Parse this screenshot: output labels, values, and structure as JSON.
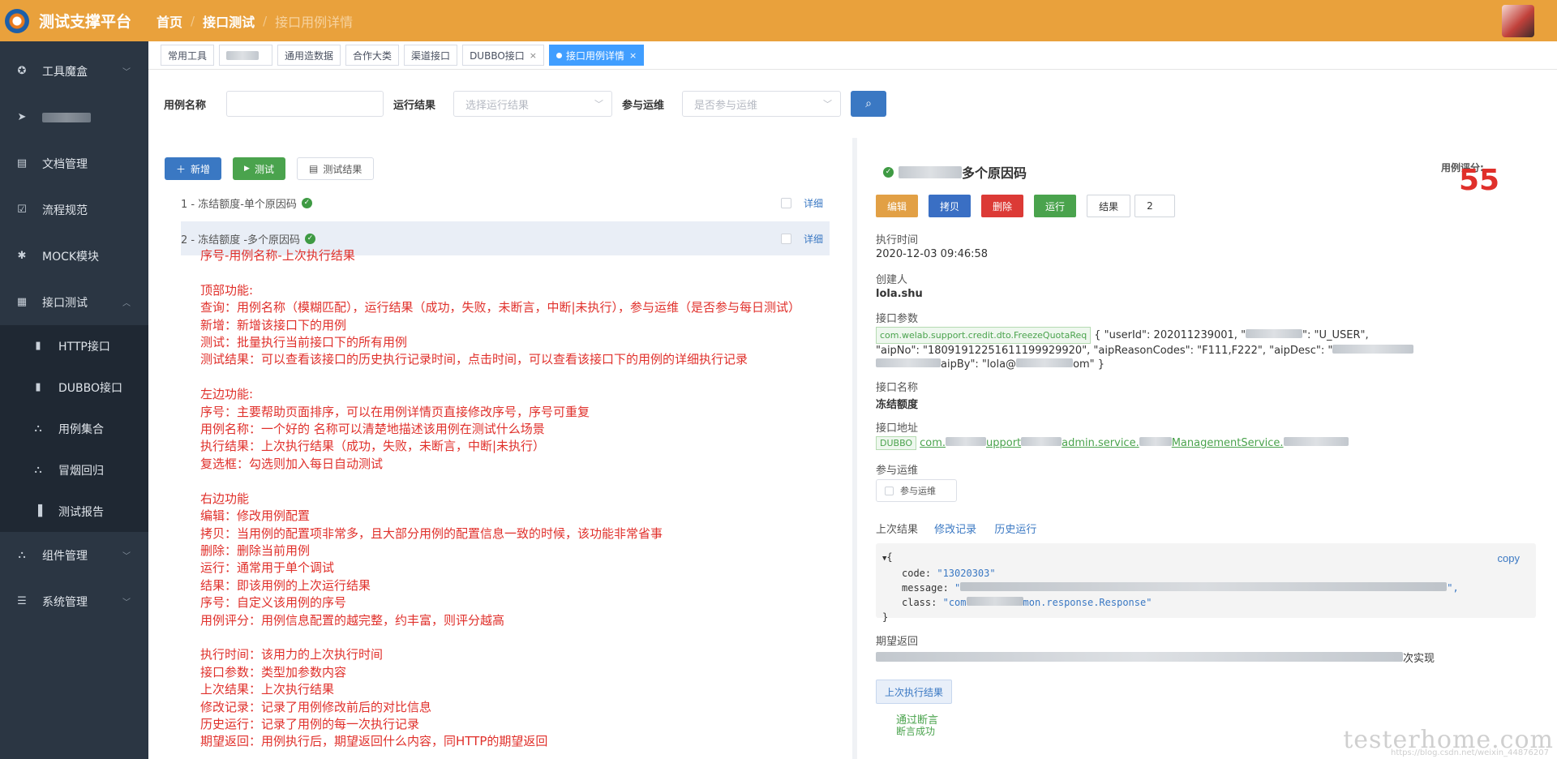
{
  "app": {
    "title": "测试支撑平台"
  },
  "sidebar": {
    "items": [
      {
        "label": "工具魔盒",
        "icon": "toolbox-icon"
      },
      {
        "label": "",
        "icon": "send-icon"
      },
      {
        "label": "文档管理",
        "icon": "document-icon"
      },
      {
        "label": "流程规范",
        "icon": "checklist-icon"
      },
      {
        "label": "MOCK模块",
        "icon": "bug-icon"
      },
      {
        "label": "接口测试",
        "icon": "grid-icon"
      },
      {
        "label": "组件管理",
        "icon": "sitemap-icon"
      },
      {
        "label": "系统管理",
        "icon": "list-icon"
      }
    ],
    "sub_items": [
      {
        "label": "HTTP接口",
        "icon": "info-icon"
      },
      {
        "label": "DUBBO接口",
        "icon": "info-icon"
      },
      {
        "label": "用例集合",
        "icon": "sitemap-icon"
      },
      {
        "label": "冒烟回归",
        "icon": "sitemap-icon"
      },
      {
        "label": "测试报告",
        "icon": "bar-chart-icon"
      }
    ]
  },
  "header": {
    "breadcrumb": [
      "首页",
      "接口测试",
      "接口用例详情"
    ]
  },
  "tabs": [
    {
      "label": "常用工具"
    },
    {
      "label": ""
    },
    {
      "label": "通用造数据"
    },
    {
      "label": "合作大类"
    },
    {
      "label": "渠道接口"
    },
    {
      "label": "DUBBO接口"
    },
    {
      "label": "接口用例详情"
    }
  ],
  "filter": {
    "name_label": "用例名称",
    "name_value": "",
    "result_label": "运行结果",
    "result_placeholder": "选择运行结果",
    "ops_label": "参与运维",
    "ops_placeholder": "是否参与运维"
  },
  "toolbar": {
    "add": "新增",
    "test": "测试",
    "test_result": "测试结果"
  },
  "cases": [
    {
      "text": "1 - 冻结额度-单个原因码",
      "detail": "详细"
    },
    {
      "text": "2 - 冻结额度 -多个原因码",
      "detail": "详细"
    }
  ],
  "annotation": "序号-用例名称-上次执行结果\n\n顶部功能:\n查询：用例名称（模糊匹配），运行结果（成功，失败，未断言，中断|未执行），参与运维（是否参与每日测试）\n新增：新增该接口下的用例\n测试：批量执行当前接口下的所有用例\n测试结果：可以查看该接口的历史执行记录时间，点击时间，可以查看该接口下的用例的详细执行记录\n\n左边功能:\n序号：主要帮助页面排序，可以在用例详情页直接修改序号，序号可重复\n用例名称：一个好的 名称可以清楚地描述该用例在测试什么场景\n执行结果：上次执行结果（成功，失败，未断言，中断|未执行）\n复选框：勾选则加入每日自动测试\n\n右边功能\n编辑：修改用例配置\n拷贝：当用例的配置项非常多，且大部分用例的配置信息一致的时候，该功能非常省事\n删除：删除当前用例\n运行：通常用于单个调试\n结果：即该用例的上次运行结果\n序号：自定义该用例的序号\n用例评分：用例信息配置的越完整，约丰富，则评分越高\n\n执行时间：该用力的上次执行时间\n接口参数：类型加参数内容\n上次结果：上次执行结果\n修改记录：记录了用例修改前后的对比信息\n历史运行：记录了用例的每一次执行记录\n期望返回：用例执行后，期望返回什么内容，同HTTP的期望返回",
  "detail": {
    "title": "多个原因码",
    "score_label": "用例评分:",
    "score": "55",
    "buttons": {
      "edit": "编辑",
      "copy": "拷贝",
      "delete": "删除",
      "run": "运行",
      "result": "结果",
      "order": "2"
    },
    "exec_time_label": "执行时间",
    "exec_time": "2020-12-03 09:46:58",
    "creator_label": "创建人",
    "creator": "lola.shu",
    "params_label": "接口参数",
    "params_type": "com.welab.support.credit.dto.FreezeQuotaReq",
    "params_line1": "{ \"userId\": 202011239001, \"",
    "params_line1b": "\": \"U_USER\",",
    "params_line2": "\"aipNo\": \"18091912251611199929920\", \"aipReasonCodes\": \"F111,F222\", \"aipDesc\": \"",
    "params_line3": "aipBy\": \"lola@",
    "params_line3b": "om\" }",
    "iface_name_label": "接口名称",
    "iface_name": "冻结额度",
    "iface_addr_label": "接口地址",
    "iface_addr_tag": "DUBBO",
    "iface_addr_parts": [
      "com.",
      "upport",
      "admin.service.",
      "ManagementService."
    ],
    "ops_label": "参与运维",
    "ops_check": "参与运维",
    "links": {
      "last": "上次结果",
      "modify": "修改记录",
      "history": "历史运行"
    },
    "json": {
      "open": "{",
      "code_key": "code:",
      "code_val": "\"13020303\"",
      "msg_key": "message:",
      "msg_val": "\"",
      "msg_end": "\",",
      "class_key": "class:",
      "class_val": "\"com",
      "class_val2": "mon.response.Response\"",
      "close": "}"
    },
    "copy": "copy",
    "expect_label": "期望返回",
    "expect_tail": "次实现",
    "last_exec_btn": "上次执行结果",
    "pass": "通过断言",
    "assert": "断言成功"
  },
  "watermark": "testerhome.com",
  "watermark_url": "https://blog.csdn.net/weixin_44876207"
}
